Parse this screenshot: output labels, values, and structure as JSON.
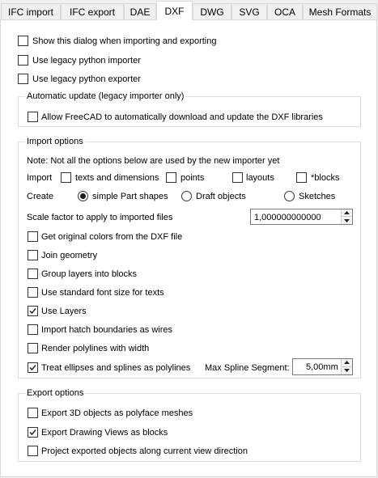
{
  "tabs": [
    {
      "label": "IFC import"
    },
    {
      "label": "IFC export"
    },
    {
      "label": "DAE"
    },
    {
      "label": "DXF",
      "active": true
    },
    {
      "label": "DWG"
    },
    {
      "label": "SVG"
    },
    {
      "label": "OCA"
    },
    {
      "label": "Mesh Formats"
    }
  ],
  "general": {
    "show_dialog": {
      "label": "Show this dialog when importing and exporting",
      "checked": false
    },
    "legacy_importer": {
      "label": "Use legacy python importer",
      "checked": false
    },
    "legacy_exporter": {
      "label": "Use legacy python exporter",
      "checked": false
    }
  },
  "auto_update": {
    "title": "Automatic update (legacy importer only)",
    "allow_download": {
      "label": "Allow FreeCAD to automatically download and update the DXF libraries",
      "checked": false
    }
  },
  "import_options": {
    "title": "Import options",
    "note": "Note: Not all the options below are used by the new importer yet",
    "import_label": "Import",
    "texts": {
      "label": "texts and dimensions",
      "checked": false
    },
    "points": {
      "label": "points",
      "checked": false
    },
    "layouts": {
      "label": "layouts",
      "checked": false
    },
    "blocks": {
      "label": "*blocks",
      "checked": false
    },
    "create_label": "Create",
    "simple_shapes": {
      "label": "simple Part shapes",
      "selected": true
    },
    "draft_objects": {
      "label": "Draft objects",
      "selected": false
    },
    "sketches": {
      "label": "Sketches",
      "selected": false
    },
    "scale_label": "Scale factor to apply to imported files",
    "scale_value": "1,000000000000",
    "original_colors": {
      "label": "Get original colors from the DXF file",
      "checked": false
    },
    "join_geometry": {
      "label": "Join geometry",
      "checked": false
    },
    "group_layers": {
      "label": "Group layers into blocks",
      "checked": false
    },
    "std_font": {
      "label": "Use standard font size for texts",
      "checked": false
    },
    "use_layers": {
      "label": "Use Layers",
      "checked": true
    },
    "hatch_wires": {
      "label": "Import hatch boundaries as wires",
      "checked": false
    },
    "polyline_width": {
      "label": "Render polylines with width",
      "checked": false
    },
    "ellipses_polylines": {
      "label": "Treat ellipses and splines as polylines",
      "checked": true
    },
    "max_spline_label": "Max Spline Segment:",
    "max_spline_value": "5,00mm"
  },
  "export_options": {
    "title": "Export options",
    "polyface": {
      "label": "Export 3D objects as polyface meshes",
      "checked": false
    },
    "drawing_views": {
      "label": "Export Drawing Views as blocks",
      "checked": true
    },
    "project_view": {
      "label": "Project exported objects along current view direction",
      "checked": false
    }
  }
}
